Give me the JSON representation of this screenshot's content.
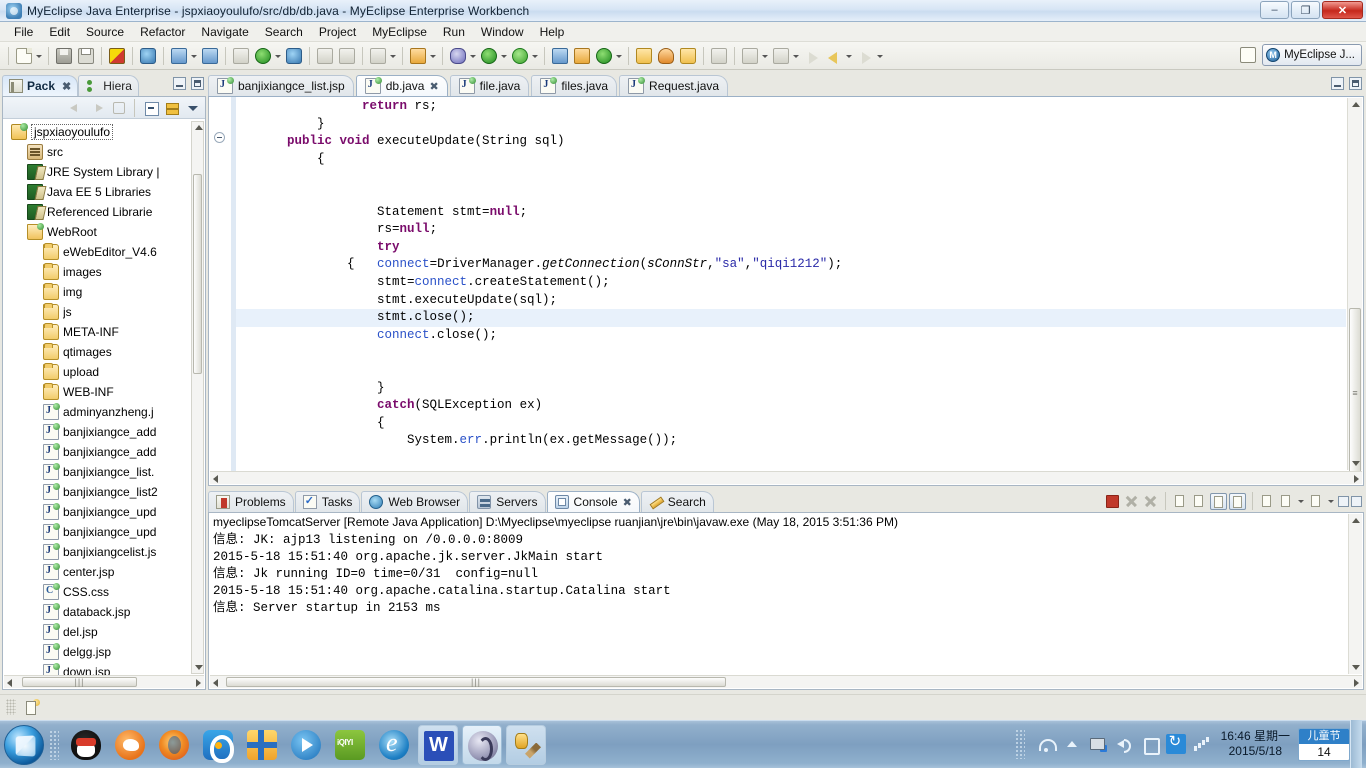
{
  "window": {
    "title": "MyEclipse Java Enterprise - jspxiaoyoulufo/src/db/db.java - MyEclipse Enterprise Workbench",
    "minimize": "–",
    "restore": "❐",
    "close": "✕"
  },
  "menubar": [
    "File",
    "Edit",
    "Source",
    "Refactor",
    "Navigate",
    "Search",
    "Project",
    "MyEclipse",
    "Run",
    "Window",
    "Help"
  ],
  "toolbar": {
    "perspective_label": "MyEclipse J...",
    "perspective_badge": "M"
  },
  "left_view": {
    "tabs": [
      {
        "label": "Pack",
        "icon": "package-explorer-icon",
        "active": true,
        "close": "✖"
      },
      {
        "label": "Hiera",
        "icon": "hierarchy-icon",
        "active": false
      }
    ],
    "tree": [
      {
        "label": "jspxiaoyoulufo",
        "icon": "project-icon",
        "indent": 0,
        "selected": true
      },
      {
        "label": "src",
        "icon": "source-folder-icon",
        "indent": 1
      },
      {
        "label": "JRE System Library |",
        "icon": "library-icon",
        "indent": 1
      },
      {
        "label": "Java EE 5 Libraries",
        "icon": "library-icon",
        "indent": 1
      },
      {
        "label": "Referenced Librarie",
        "icon": "library-icon",
        "indent": 1
      },
      {
        "label": "WebRoot",
        "icon": "webroot-folder-icon",
        "indent": 1
      },
      {
        "label": "eWebEditor_V4.6",
        "icon": "folder-icon",
        "indent": 2
      },
      {
        "label": "images",
        "icon": "folder-icon",
        "indent": 2
      },
      {
        "label": "img",
        "icon": "folder-icon",
        "indent": 2
      },
      {
        "label": "js",
        "icon": "folder-icon",
        "indent": 2
      },
      {
        "label": "META-INF",
        "icon": "folder-icon",
        "indent": 2
      },
      {
        "label": "qtimages",
        "icon": "folder-icon",
        "indent": 2
      },
      {
        "label": "upload",
        "icon": "folder-icon",
        "indent": 2
      },
      {
        "label": "WEB-INF",
        "icon": "folder-icon",
        "indent": 2
      },
      {
        "label": "adminyanzheng.j",
        "icon": "jsp-file-icon",
        "indent": 2
      },
      {
        "label": "banjixiangce_add",
        "icon": "jsp-file-icon",
        "indent": 2
      },
      {
        "label": "banjixiangce_add",
        "icon": "jsp-file-icon",
        "indent": 2
      },
      {
        "label": "banjixiangce_list.",
        "icon": "jsp-file-icon",
        "indent": 2
      },
      {
        "label": "banjixiangce_list2",
        "icon": "jsp-file-icon",
        "indent": 2
      },
      {
        "label": "banjixiangce_upd",
        "icon": "jsp-file-icon",
        "indent": 2
      },
      {
        "label": "banjixiangce_upd",
        "icon": "jsp-file-icon",
        "indent": 2
      },
      {
        "label": "banjixiangcelist.js",
        "icon": "jsp-file-icon",
        "indent": 2
      },
      {
        "label": "center.jsp",
        "icon": "jsp-file-icon",
        "indent": 2
      },
      {
        "label": "CSS.css",
        "icon": "css-file-icon",
        "indent": 2
      },
      {
        "label": "databack.jsp",
        "icon": "jsp-file-icon",
        "indent": 2
      },
      {
        "label": "del.jsp",
        "icon": "jsp-file-icon",
        "indent": 2
      },
      {
        "label": "delgg.jsp",
        "icon": "jsp-file-icon",
        "indent": 2
      },
      {
        "label": "down.jsp",
        "icon": "jsp-file-icon",
        "indent": 2
      }
    ]
  },
  "editor": {
    "tabs": [
      {
        "label": "banjixiangce_list.jsp",
        "icon": "jsp-file-icon",
        "active": false
      },
      {
        "label": "db.java",
        "icon": "java-file-icon",
        "active": true,
        "close": "✖"
      },
      {
        "label": "file.java",
        "icon": "java-file-icon",
        "active": false
      },
      {
        "label": "files.java",
        "icon": "java-file-icon",
        "active": false
      },
      {
        "label": "Request.java",
        "icon": "java-file-icon",
        "active": false
      }
    ],
    "code_lines": [
      {
        "indent": 8,
        "highlight": false,
        "parts": [
          {
            "t": "return ",
            "c": "kw"
          },
          {
            "t": "rs;",
            "c": ""
          }
        ]
      },
      {
        "indent": 5,
        "highlight": false,
        "parts": [
          {
            "t": "}",
            "c": ""
          }
        ]
      },
      {
        "indent": 3,
        "highlight": false,
        "parts": [
          {
            "t": "public void ",
            "c": "kw"
          },
          {
            "t": "executeUpdate(String sql)",
            "c": ""
          }
        ]
      },
      {
        "indent": 5,
        "highlight": false,
        "parts": [
          {
            "t": "{",
            "c": ""
          }
        ]
      },
      {
        "indent": 0,
        "highlight": false,
        "parts": []
      },
      {
        "indent": 0,
        "highlight": false,
        "parts": []
      },
      {
        "indent": 9,
        "highlight": false,
        "parts": [
          {
            "t": "Statement stmt=",
            "c": ""
          },
          {
            "t": "null",
            "c": "kw"
          },
          {
            "t": ";",
            "c": ""
          }
        ]
      },
      {
        "indent": 9,
        "highlight": false,
        "parts": [
          {
            "t": "rs=",
            "c": ""
          },
          {
            "t": "null",
            "c": "kw"
          },
          {
            "t": ";",
            "c": ""
          }
        ]
      },
      {
        "indent": 9,
        "highlight": false,
        "parts": [
          {
            "t": "try",
            "c": "kw"
          }
        ]
      },
      {
        "indent": 7,
        "highlight": false,
        "parts": [
          {
            "t": "{   ",
            "c": ""
          },
          {
            "t": "connect",
            "c": "fld"
          },
          {
            "t": "=DriverManager.",
            "c": ""
          },
          {
            "t": "getConnection",
            "c": "ital"
          },
          {
            "t": "(",
            "c": ""
          },
          {
            "t": "sConnStr",
            "c": "ital"
          },
          {
            "t": ",",
            "c": ""
          },
          {
            "t": "\"sa\"",
            "c": "str"
          },
          {
            "t": ",",
            "c": ""
          },
          {
            "t": "\"qiqi1212\"",
            "c": "str"
          },
          {
            "t": ");",
            "c": ""
          }
        ]
      },
      {
        "indent": 9,
        "highlight": false,
        "parts": [
          {
            "t": "stmt=",
            "c": ""
          },
          {
            "t": "connect",
            "c": "fld"
          },
          {
            "t": ".createStatement();",
            "c": ""
          }
        ]
      },
      {
        "indent": 9,
        "highlight": false,
        "parts": [
          {
            "t": "stmt.executeUpdate(sql);",
            "c": ""
          }
        ]
      },
      {
        "indent": 9,
        "highlight": true,
        "parts": [
          {
            "t": "stmt.close();",
            "c": ""
          }
        ]
      },
      {
        "indent": 9,
        "highlight": false,
        "parts": [
          {
            "t": "connect",
            "c": "fld"
          },
          {
            "t": ".close();",
            "c": ""
          }
        ]
      },
      {
        "indent": 0,
        "highlight": false,
        "parts": []
      },
      {
        "indent": 0,
        "highlight": false,
        "parts": []
      },
      {
        "indent": 9,
        "highlight": false,
        "parts": [
          {
            "t": "}",
            "c": ""
          }
        ]
      },
      {
        "indent": 9,
        "highlight": false,
        "parts": [
          {
            "t": "catch",
            "c": "kw"
          },
          {
            "t": "(SQLException ex)",
            "c": ""
          }
        ]
      },
      {
        "indent": 9,
        "highlight": false,
        "parts": [
          {
            "t": "{",
            "c": ""
          }
        ]
      },
      {
        "indent": 11,
        "highlight": false,
        "parts": [
          {
            "t": "System.",
            "c": ""
          },
          {
            "t": "err",
            "c": "fld"
          },
          {
            "t": ".println(ex.getMessage());",
            "c": ""
          }
        ]
      },
      {
        "indent": 0,
        "highlight": false,
        "parts": []
      },
      {
        "indent": 0,
        "highlight": false,
        "parts": []
      },
      {
        "indent": 9,
        "highlight": false,
        "parts": [
          {
            "t": "}",
            "c": ""
          }
        ]
      },
      {
        "indent": 0,
        "highlight": false,
        "parts": []
      },
      {
        "indent": 0,
        "highlight": false,
        "parts": []
      },
      {
        "indent": 5,
        "highlight": false,
        "parts": [
          {
            "t": "}",
            "c": ""
          }
        ]
      }
    ]
  },
  "console": {
    "tabs": [
      {
        "label": "Problems",
        "icon": "problems-icon",
        "active": false
      },
      {
        "label": "Tasks",
        "icon": "tasks-icon",
        "active": false
      },
      {
        "label": "Web Browser",
        "icon": "web-browser-icon",
        "active": false
      },
      {
        "label": "Servers",
        "icon": "servers-icon",
        "active": false
      },
      {
        "label": "Console",
        "icon": "console-icon",
        "active": true,
        "close": "✖"
      },
      {
        "label": "Search",
        "icon": "search-icon",
        "active": false
      }
    ],
    "header": "myeclipseTomcatServer [Remote Java Application] D:\\Myeclipse\\myeclipse ruanjian\\jre\\bin\\javaw.exe (May 18, 2015 3:51:36 PM)",
    "lines": [
      "信息: JK: ajp13 listening on /0.0.0.0:8009",
      "2015-5-18 15:51:40 org.apache.jk.server.JkMain start",
      "信息: Jk running ID=0 time=0/31  config=null",
      "2015-5-18 15:51:40 org.apache.catalina.startup.Catalina start",
      "信息: Server startup in 2153 ms"
    ]
  },
  "taskbar": {
    "items": [
      {
        "name": "qq-icon",
        "glyph": "g-qq",
        "framed": false
      },
      {
        "name": "sogou-browser-icon",
        "glyph": "g-bird",
        "framed": false
      },
      {
        "name": "firefox-icon",
        "glyph": "g-ff",
        "framed": false
      },
      {
        "name": "pplive-icon",
        "glyph": "g-pp",
        "framed": false
      },
      {
        "name": "thunder-icon",
        "glyph": "g-gift",
        "framed": false
      },
      {
        "name": "media-player-icon",
        "glyph": "g-play",
        "framed": false
      },
      {
        "name": "iqiyi-icon",
        "glyph": "g-iqiyi",
        "framed": false
      },
      {
        "name": "internet-explorer-icon",
        "glyph": "g-ie",
        "framed": false
      },
      {
        "name": "word-window-button",
        "glyph": "g-w",
        "framed": true,
        "active": false
      },
      {
        "name": "myeclipse-window-button",
        "glyph": "g-myeclipse",
        "framed": true,
        "active": true
      },
      {
        "name": "database-tool-window-button",
        "glyph": "g-db",
        "framed": true,
        "active": false
      }
    ],
    "clock_time": "16:46 星期一",
    "clock_date": "2015/5/18",
    "festival_label": "儿童节",
    "festival_days": "14"
  }
}
